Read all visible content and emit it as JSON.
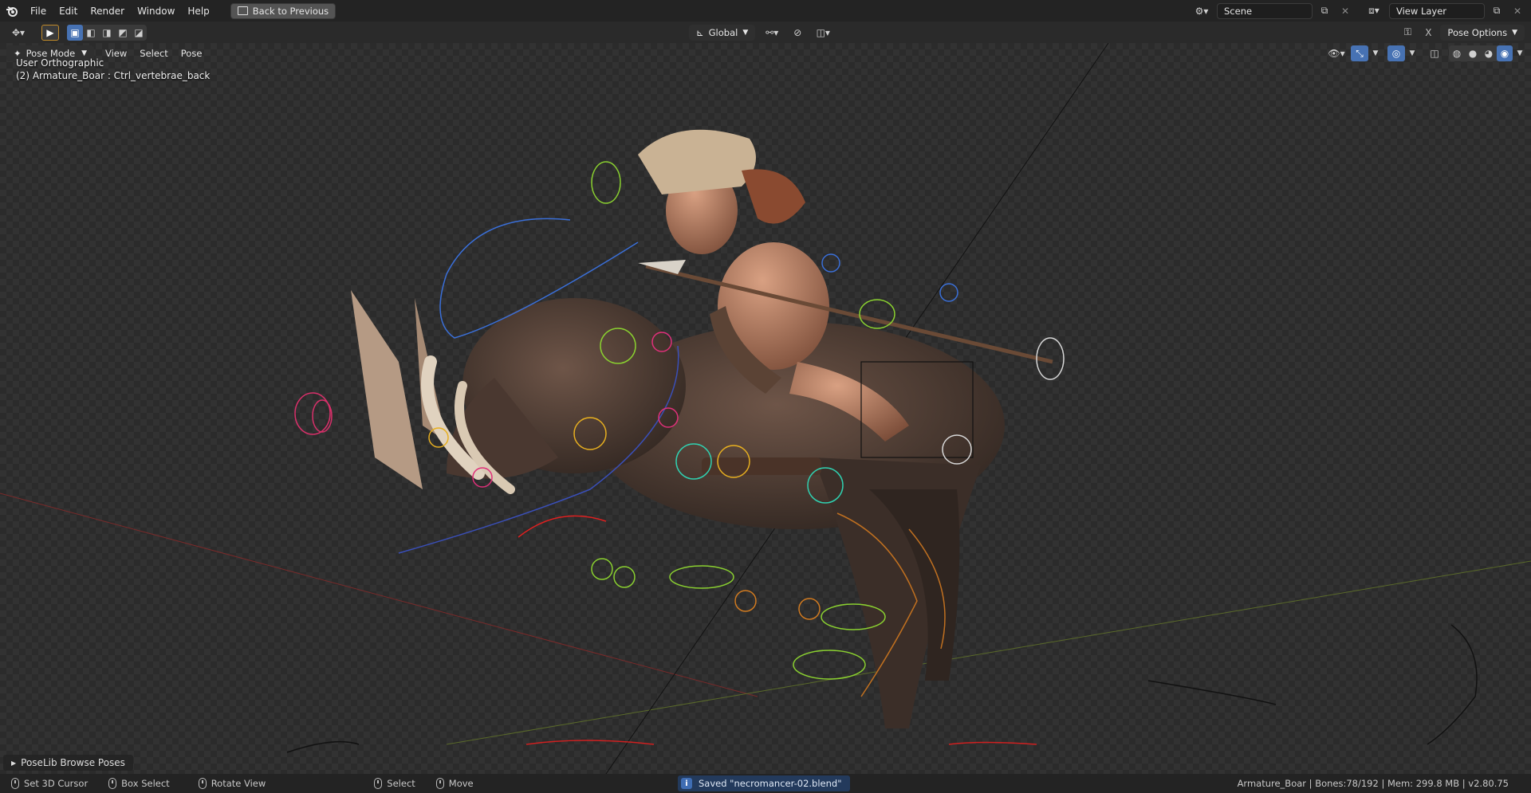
{
  "menu": {
    "items": [
      "File",
      "Edit",
      "Render",
      "Window",
      "Help"
    ],
    "back_button": "Back to Previous"
  },
  "topbar_right": {
    "scene_name": "Scene",
    "view_layer_name": "View Layer"
  },
  "toolbar": {
    "orientation": "Global",
    "pose_options": "Pose Options",
    "x_mirror": "X"
  },
  "viewport_header": {
    "mode": "Pose Mode",
    "menus": [
      "View",
      "Select",
      "Pose"
    ]
  },
  "viewport": {
    "view_name": "User Orthographic",
    "active_info": "(2) Armature_Boar : Ctrl_vertebrae_back",
    "poselib_panel": "PoseLib Browse Poses"
  },
  "statusbar": {
    "items": [
      {
        "label": "Set 3D Cursor"
      },
      {
        "label": "Box Select"
      },
      {
        "label": "Rotate View"
      },
      {
        "label": "Select"
      },
      {
        "label": "Move"
      }
    ],
    "message": "Saved \"necromancer-02.blend\"",
    "stats": "Armature_Boar | Bones:78/192 | Mem: 299.8 MB | v2.80.75"
  },
  "icons": {
    "app": "blender-logo-icon",
    "accent": "#4772b3"
  }
}
